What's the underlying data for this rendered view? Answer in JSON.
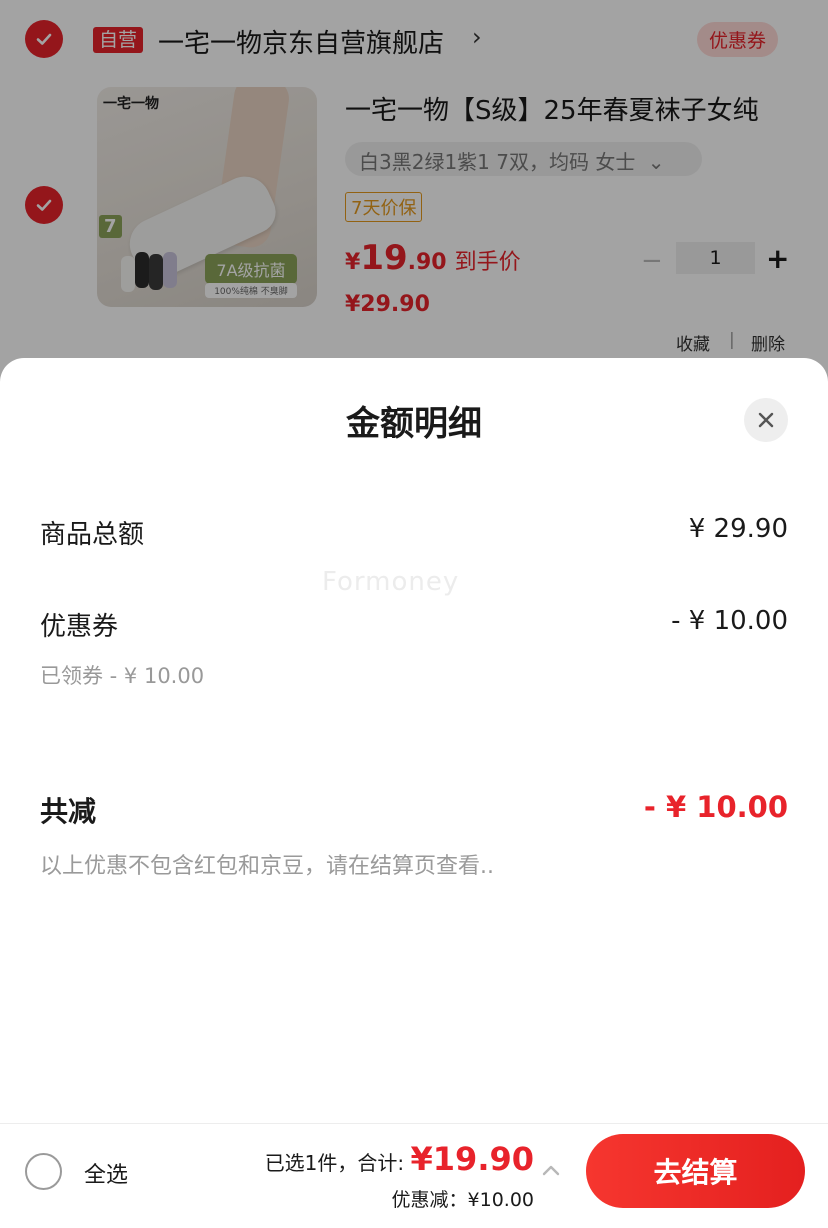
{
  "store": {
    "self_operated_badge": "自营",
    "name": "一宅一物京东自营旗舰店",
    "arrow": "›",
    "coupon_label": "优惠券"
  },
  "product": {
    "image_logo": "一宅一物",
    "image_badge_count": "7",
    "image_badge_7a": "7A级抗菌",
    "image_badge_sub": "100%纯棉  不臭脚",
    "title": "一宅一物【S级】25年春夏袜子女纯",
    "spec": "白3黑2绿1紫1 7双，均码 女士",
    "spec_chevron": "⌄",
    "price_guarantee": "7天价保",
    "price_symbol": "¥",
    "price_integer": "19",
    "price_decimal": ".90",
    "price_tag": "到手价",
    "original_price": "¥29.90",
    "quantity": "1",
    "minus": "−",
    "plus": "+",
    "action_favorite": "收藏",
    "action_separator": "|",
    "action_delete": "删除"
  },
  "sheet": {
    "title": "金额明细",
    "watermark": "Formoney",
    "goods_total_label": "商品总额",
    "goods_total_value": "¥ 29.90",
    "coupon_label": "优惠券",
    "coupon_value": "- ¥ 10.00",
    "coupon_note": "已领券 - ¥ 10.00",
    "total_reduction_label": "共减",
    "total_reduction_value": "- ¥ 10.00",
    "disclaimer": "以上优惠不包含红包和京豆，请在结算页查看.."
  },
  "bottom_bar": {
    "select_all_label": "全选",
    "summary_text": "已选1件，合计: ",
    "summary_price": "¥19.90",
    "discount_text": "优惠减：¥10.00",
    "checkout_label": "去结算"
  },
  "colors": {
    "accent_red": "#e8232b",
    "guarantee_orange": "#e59a1f",
    "muted_text": "#999999"
  }
}
